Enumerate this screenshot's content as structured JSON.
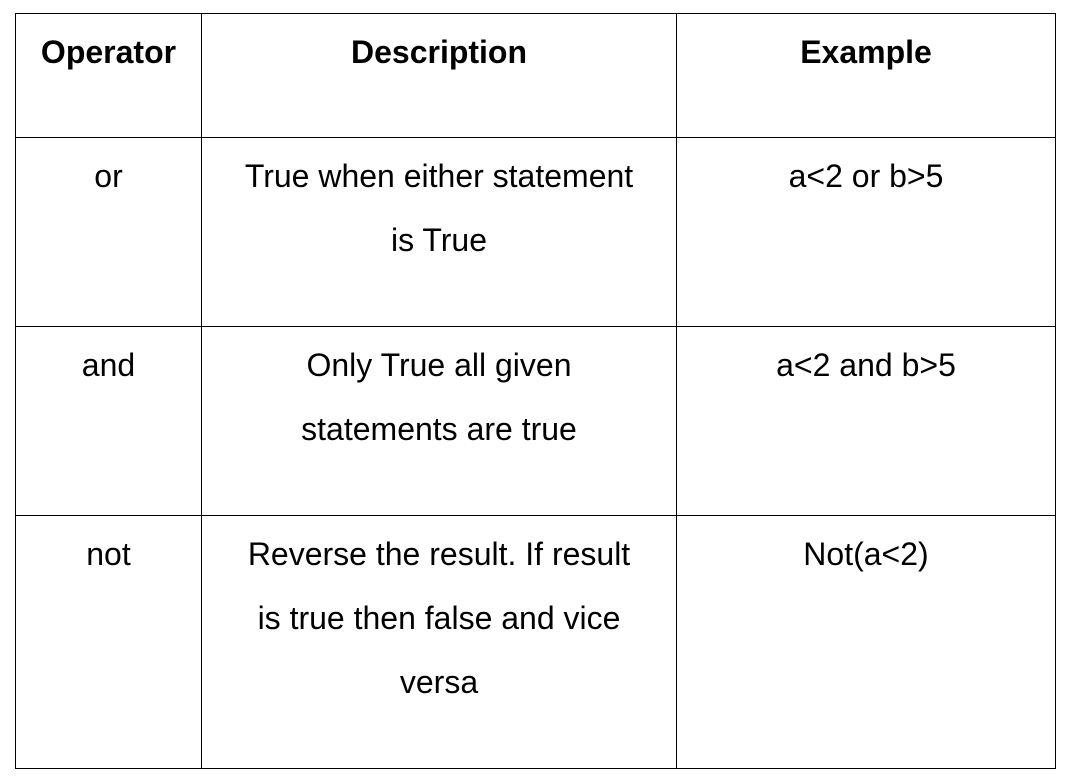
{
  "table": {
    "headers": {
      "operator": "Operator",
      "description": "Description",
      "example": "Example"
    },
    "rows": [
      {
        "operator": "or",
        "description": "True when either statement is True",
        "example": "a<2 or b>5"
      },
      {
        "operator": "and",
        "description": "Only True all given statements are true",
        "example": "a<2 and b>5"
      },
      {
        "operator": "not",
        "description": "Reverse the result. If result is true then false and vice versa",
        "example": "Not(a<2)"
      }
    ]
  }
}
